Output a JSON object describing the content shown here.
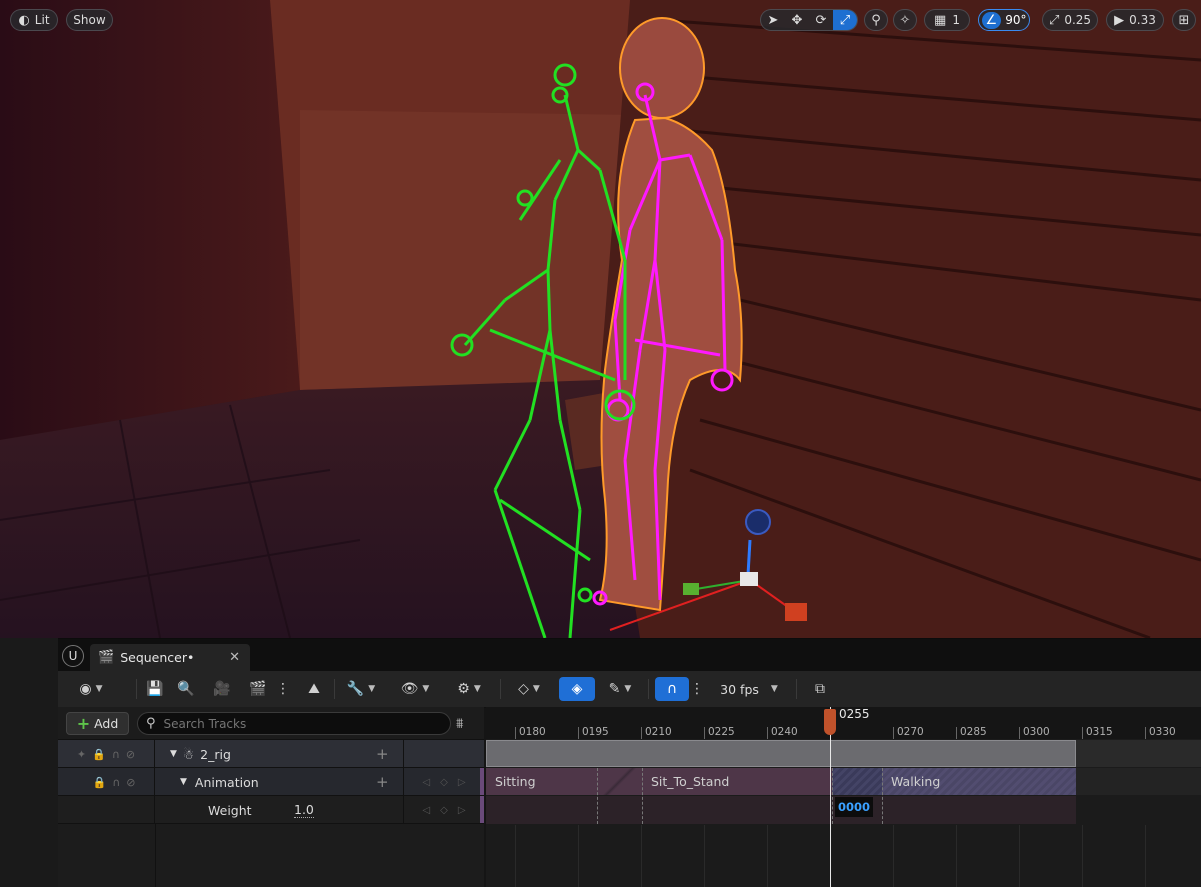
{
  "viewport": {
    "lit_label": "Lit",
    "show_label": "Show",
    "grid_snap": "1",
    "rotation_snap": "90°",
    "scale_snap": "0.25",
    "camera_speed": "0.33"
  },
  "sequencer": {
    "tab_title": "Sequencer•",
    "fps_label": "30 fps",
    "add_label": "Add",
    "search_placeholder": "Search Tracks",
    "tracks": [
      {
        "label": "2_rig"
      },
      {
        "label": "Animation"
      },
      {
        "label": "Weight",
        "value": "1.0"
      }
    ],
    "ruler": [
      "0180",
      "0195",
      "0210",
      "0225",
      "0240",
      "0255",
      "0270",
      "0285",
      "0300",
      "0315",
      "0330"
    ],
    "playhead_frame": "0255",
    "sections": [
      "Sitting",
      "Sit_To_Stand",
      "Walking"
    ],
    "weight_frame_value": "0000"
  },
  "colors": {
    "accent": "#1f6fd6",
    "playhead": "#c0522b",
    "rig_green": "#22e022",
    "rig_magenta": "#ff19ff",
    "outline_orange": "#ff9a2a"
  }
}
